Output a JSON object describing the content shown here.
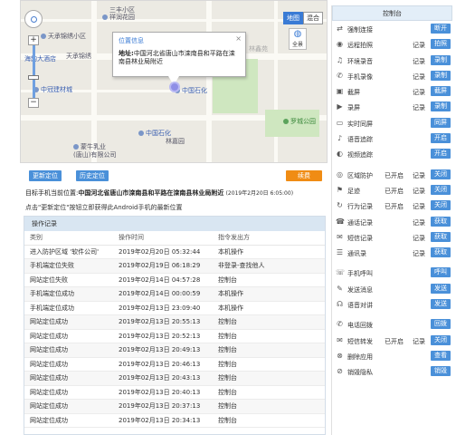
{
  "map": {
    "type_buttons": [
      {
        "label": "地图",
        "active": true
      },
      {
        "label": "混合",
        "active": false
      }
    ],
    "panorama_label": "全景",
    "zoom_in": "+",
    "zoom_out": "−",
    "labels": {
      "sanshan": "三丰小区",
      "xiangrun": "祥润花园",
      "tiancheng_jin": "天承锦绣小区",
      "tiancheng": "天承锦绣",
      "haiyun": "海韵大酒店",
      "zhongqu": "中冠建材城",
      "zhongguo_shihua_1": "中国石化",
      "zhongguo_shihua_2": "中国石化",
      "linjia": "林嘉园",
      "luocheng": "罗城公园",
      "mengniu_1": "蒙牛乳业",
      "mengniu_2": "(唐山)有限公司",
      "linyinfeng": "林鑫苑"
    },
    "bubble": {
      "title": "位置信息",
      "address_label": "地址:",
      "address": "中国河北省唐山市滦南县和平路在滦南县林业局附近"
    }
  },
  "buttons": {
    "refresh": "更新定位",
    "history": "历史定位",
    "renew": "续费"
  },
  "location": {
    "prefix": "目标手机当前位置:",
    "address": "中国河北省唐山市滦南县和平路在滦南县林业局附近",
    "time": "(2019年2月20日 6:05:00)"
  },
  "hint": "点击\"更新定位\"按钮立即获得此Android手机的最新位置",
  "log": {
    "title": "操作记录",
    "columns": [
      "类别",
      "操作时间",
      "指令发出方"
    ],
    "rows": [
      [
        "进入防护区域 '软件公司'",
        "2019年02月20日 05:32:44",
        "本机操作"
      ],
      [
        "手机端定位失败",
        "2019年02月19日 06:18:29",
        "非登录-查找他人"
      ],
      [
        "网站定位失败",
        "2019年02月14日 04:57:28",
        "控制台"
      ],
      [
        "手机端定位成功",
        "2019年02月14日 00:00:59",
        "本机操作"
      ],
      [
        "手机端定位成功",
        "2019年02月13日 23:09:40",
        "本机操作"
      ],
      [
        "网站定位成功",
        "2019年02月13日 20:55:13",
        "控制台"
      ],
      [
        "网站定位成功",
        "2019年02月13日 20:52:13",
        "控制台"
      ],
      [
        "网站定位成功",
        "2019年02月13日 20:49:13",
        "控制台"
      ],
      [
        "网站定位成功",
        "2019年02月13日 20:46:13",
        "控制台"
      ],
      [
        "网站定位成功",
        "2019年02月13日 20:43:13",
        "控制台"
      ],
      [
        "网站定位成功",
        "2019年02月13日 20:40:13",
        "控制台"
      ],
      [
        "网站定位成功",
        "2019年02月13日 20:37:13",
        "控制台"
      ],
      [
        "网站定位成功",
        "2019年02月13日 20:34:13",
        "控制台"
      ]
    ]
  },
  "control": {
    "title": "控制台",
    "rows": [
      {
        "icon": "⇄",
        "label": "强制连接",
        "status": "",
        "rec": "",
        "btn": "断开",
        "icon_name": "link-icon"
      },
      {
        "icon": "◉",
        "label": "远程拍照",
        "status": "",
        "rec": "记录",
        "btn": "拍照",
        "icon_name": "camera-icon"
      },
      {
        "icon": "♫",
        "label": "环境录音",
        "status": "",
        "rec": "记录",
        "btn": "录制",
        "icon_name": "mic-icon"
      },
      {
        "icon": "✆",
        "label": "手机录像",
        "status": "",
        "rec": "记录",
        "btn": "录制",
        "icon_name": "video-icon"
      },
      {
        "icon": "▣",
        "label": "截屏",
        "status": "",
        "rec": "记录",
        "btn": "截屏",
        "icon_name": "screenshot-icon"
      },
      {
        "icon": "▶",
        "label": "录屏",
        "status": "",
        "rec": "记录",
        "btn": "录制",
        "icon_name": "screen-record-icon"
      },
      {
        "icon": "▭",
        "label": "实时同屏",
        "status": "",
        "rec": "",
        "btn": "同屏",
        "icon_name": "mirror-icon"
      },
      {
        "icon": "♪",
        "label": "语音追踪",
        "status": "",
        "rec": "",
        "btn": "开启",
        "icon_name": "voice-track-icon"
      },
      {
        "icon": "◐",
        "label": "视频追踪",
        "status": "",
        "rec": "",
        "btn": "开启",
        "icon_name": "video-track-icon"
      },
      {
        "icon": "◎",
        "label": "区域防护",
        "status": "已开启",
        "rec": "记录",
        "btn": "关闭",
        "icon_name": "geofence-icon",
        "gap": true
      },
      {
        "icon": "⚑",
        "label": "足迹",
        "status": "已开启",
        "rec": "记录",
        "btn": "关闭",
        "icon_name": "footprint-icon"
      },
      {
        "icon": "↻",
        "label": "行为记录",
        "status": "已开启",
        "rec": "记录",
        "btn": "关闭",
        "icon_name": "behavior-icon"
      },
      {
        "icon": "☎",
        "label": "通话记录",
        "status": "",
        "rec": "记录",
        "btn": "获取",
        "icon_name": "call-log-icon"
      },
      {
        "icon": "✉",
        "label": "短信记录",
        "status": "",
        "rec": "记录",
        "btn": "获取",
        "icon_name": "sms-log-icon"
      },
      {
        "icon": "☰",
        "label": "通讯录",
        "status": "",
        "rec": "记录",
        "btn": "获取",
        "icon_name": "contacts-icon"
      },
      {
        "icon": "☏",
        "label": "手机呼叫",
        "status": "",
        "rec": "",
        "btn": "呼叫",
        "icon_name": "dial-icon",
        "gap": true
      },
      {
        "icon": "✎",
        "label": "发送消息",
        "status": "",
        "rec": "",
        "btn": "发送",
        "icon_name": "message-icon"
      },
      {
        "icon": "☊",
        "label": "语音对讲",
        "status": "",
        "rec": "",
        "btn": "发送",
        "icon_name": "intercom-icon"
      },
      {
        "icon": "✆",
        "label": "电话回拨",
        "status": "",
        "rec": "",
        "btn": "回拨",
        "icon_name": "callback-icon",
        "gap": true
      },
      {
        "icon": "✉",
        "label": "短信转发",
        "status": "已开启",
        "rec": "记录",
        "btn": "关闭",
        "icon_name": "sms-forward-icon"
      },
      {
        "icon": "⊗",
        "label": "删除应用",
        "status": "",
        "rec": "",
        "btn": "查看",
        "icon_name": "delete-app-icon"
      },
      {
        "icon": "⊘",
        "label": "销毁隐私",
        "status": "",
        "rec": "",
        "btn": "销毁",
        "icon_name": "wipe-icon"
      }
    ]
  },
  "colors": {
    "primary_button": "#4a90d9",
    "renew_button": "#f08c14",
    "header_bg": "#d9e6f2"
  }
}
